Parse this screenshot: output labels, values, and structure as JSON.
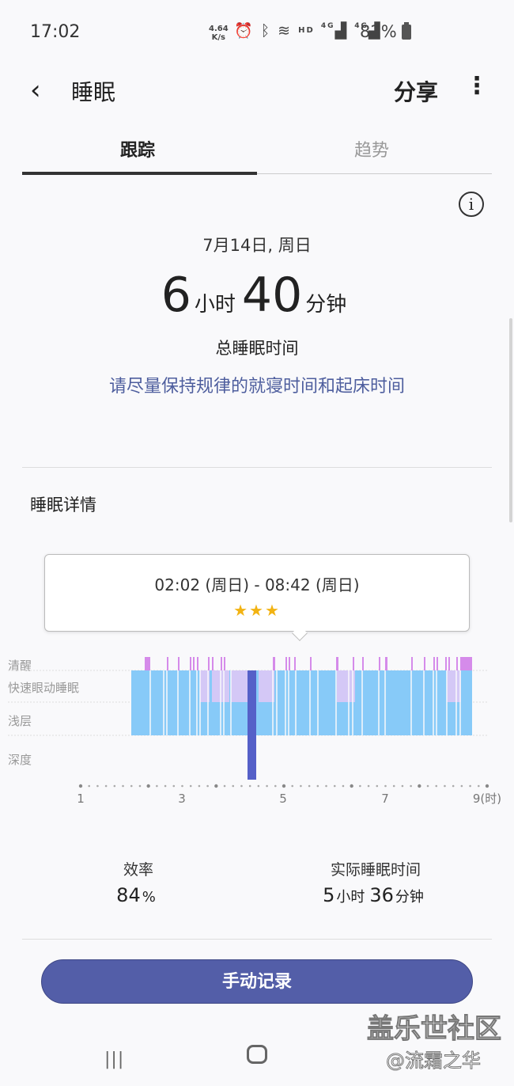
{
  "status_bar": {
    "time": "17:02",
    "net_speed_top": "4.64",
    "net_speed_bottom": "K/s",
    "battery": "82%"
  },
  "header": {
    "back_icon": "chevron-left-icon",
    "title": "睡眠",
    "share_label": "分享",
    "more_icon": "more-vertical-icon"
  },
  "tabs": [
    {
      "label": "跟踪",
      "active": true
    },
    {
      "label": "趋势",
      "active": false
    }
  ],
  "summary": {
    "date": "7月14日, 周日",
    "hours": "6",
    "hours_unit": "小时",
    "minutes": "40",
    "minutes_unit": "分钟",
    "total_label": "总睡眠时间",
    "advice": "请尽量保持规律的就寝时间和起床时间"
  },
  "details": {
    "title": "睡眠详情",
    "range": "02:02 (周日) - 08:42 (周日)",
    "stars": "★★★",
    "stage_labels": [
      "清醒",
      "快速眼动睡眠",
      "浅层",
      "深度"
    ],
    "axis_labels": [
      "1",
      "3",
      "5",
      "7",
      "9(时)"
    ],
    "efficiency_label": "效率",
    "efficiency_value": "84",
    "efficiency_unit": "%",
    "actual_label": "实际睡眠时间",
    "actual_hours": "5",
    "actual_hours_unit": "小时",
    "actual_minutes": "36",
    "actual_minutes_unit": "分钟"
  },
  "manual_button": "手动记录",
  "watermark": {
    "line1": "盖乐世社区",
    "line2": "@流霜之华"
  },
  "colors": {
    "accent": "#535ea8",
    "advice_text": "#4e5e9e",
    "awake": "#d58bea",
    "rem": "#d4c8f6",
    "light": "#87caf8",
    "deep": "#5560c8",
    "stars": "#f2b313"
  }
}
